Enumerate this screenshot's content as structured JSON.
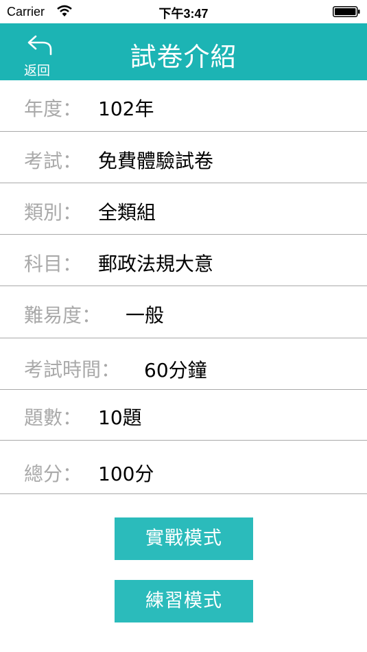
{
  "status_bar": {
    "carrier": "Carrier",
    "time": "下午3:47"
  },
  "nav": {
    "back_label": "返回",
    "title": "試卷介紹",
    "color": "#1cb4b4"
  },
  "info": [
    {
      "label": "年度：",
      "value": "102年"
    },
    {
      "label": "考試：",
      "value": "免費體驗試卷"
    },
    {
      "label": "類別：",
      "value": "全類組"
    },
    {
      "label": "科目：",
      "value": "郵政法規大意"
    },
    {
      "label": "難易度：",
      "value": "一般"
    },
    {
      "label": "考試時間：",
      "value": "60分鐘"
    },
    {
      "label": "題數：",
      "value": "10題"
    },
    {
      "label": "總分：",
      "value": "100分"
    }
  ],
  "buttons": {
    "practical": "實戰模式",
    "practice": "練習模式",
    "color": "#2bbbbb"
  }
}
